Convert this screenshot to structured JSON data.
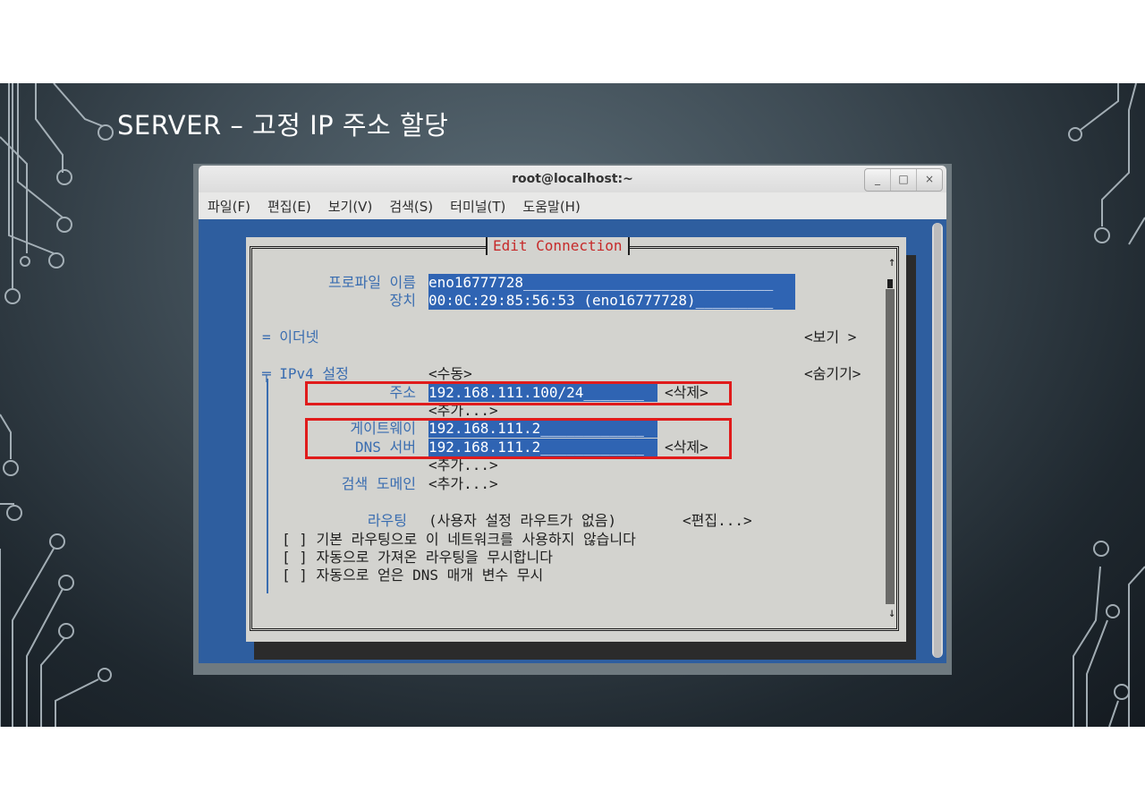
{
  "slide": {
    "title": "SERVER – 고정 IP 주소 할당"
  },
  "window": {
    "title": "root@localhost:~",
    "buttons": {
      "minimize": "_",
      "maximize": "□",
      "close": "×"
    }
  },
  "menubar": {
    "items": [
      "파일(F)",
      "편집(E)",
      "보기(V)",
      "검색(S)",
      "터미널(T)",
      "도움말(H)"
    ]
  },
  "dialog": {
    "title": "Edit Connection",
    "profile_name_label": "프로파일 이름",
    "profile_name_value": "eno16777728_____________________________",
    "device_label": "장치",
    "device_value": "00:0C:29:85:56:53 (eno16777728)_________",
    "ethernet_label": "= 이더넷",
    "ethernet_button": "<보기 >",
    "ipv4_label": "╤ IPv4 설정",
    "ipv4_mode": "<수동>",
    "ipv4_hide_button": "<숨기기>",
    "address_label": "주소",
    "address_value": "192.168.111.100/24_______",
    "address_delete": "<삭제>",
    "address_add": "<추가...>",
    "gateway_label": "게이트웨이",
    "gateway_value": "192.168.111.2____________",
    "dns_label": "DNS 서버",
    "dns_value": "192.168.111.2____________",
    "dns_delete": "<삭제>",
    "dns_add": "<추가...>",
    "search_domain_label": "검색 도메인",
    "search_domain_add": "<추가...>",
    "routing_label": "라우팅",
    "routing_value": "(사용자 설정 라우트가 없음)",
    "routing_edit": "<편집...>",
    "checkboxes": [
      {
        "box": "[ ]",
        "label": "기본 라우팅으로 이 네트워크를 사용하지 않습니다"
      },
      {
        "box": "[ ]",
        "label": "자동으로 가져온 라우팅을 무시합니다"
      },
      {
        "box": "[ ]",
        "label": "자동으로 얻은 DNS 매개 변수 무시"
      }
    ],
    "scroll_up": "↑",
    "scroll_down": "↓"
  },
  "colors": {
    "terminal_bg": "#2e5e9f",
    "dialog_bg": "#d3d3cf",
    "field_bg": "#2f64b3",
    "title_red": "#c62a2a",
    "highlight_red": "#e01b1b",
    "label_blue": "#3a6db0"
  }
}
